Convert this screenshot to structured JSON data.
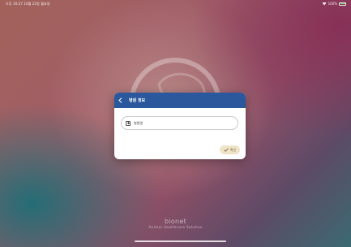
{
  "status_bar": {
    "time_date": "오후 10:27 10월 22일 월요일",
    "wifi_icon": "wifi-icon",
    "battery_text": "100%",
    "battery_level": 1.0
  },
  "dialog": {
    "title": "병원 정보",
    "back_icon": "chevron-left-icon",
    "field_icon": "hospital-icon",
    "field_value": "병원명",
    "confirm_icon": "check-icon",
    "confirm_label": "확인"
  },
  "brand": {
    "name": "bionet",
    "tagline": "Animal Healthcare Solution"
  },
  "colors": {
    "header": "#2b579c",
    "confirm_button_bg": "#efe4c8",
    "battery_fill": "#55e05a"
  }
}
